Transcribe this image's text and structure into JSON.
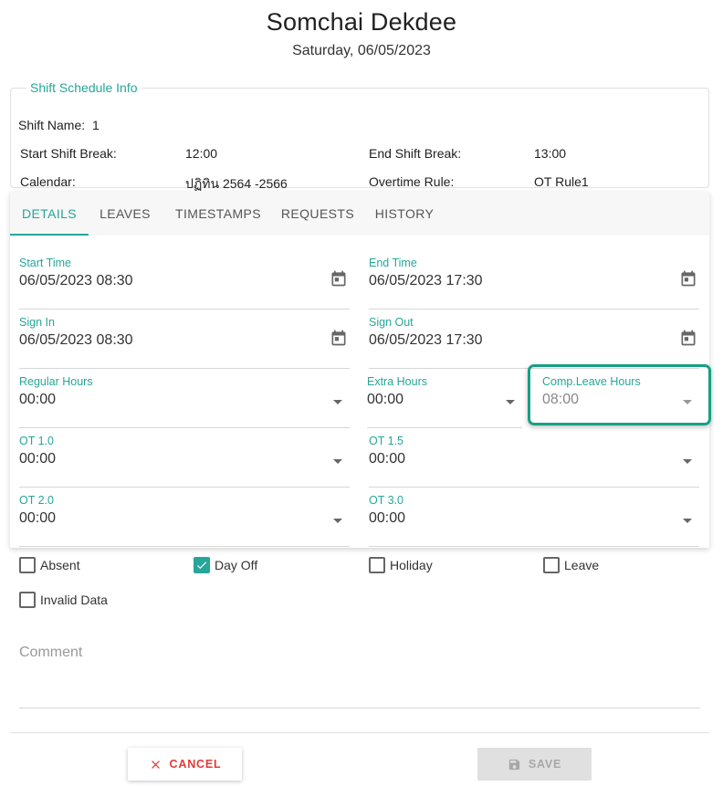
{
  "header": {
    "name": "Somchai Dekdee",
    "date": "Saturday, 06/05/2023"
  },
  "shift_info": {
    "legend": "Shift Schedule Info",
    "shift_name_label": "Shift Name:",
    "shift_name_value": "1",
    "start_break_label": "Start Shift Break:",
    "start_break_value": "12:00",
    "end_break_label": "End Shift Break:",
    "end_break_value": "13:00",
    "calendar_label": "Calendar:",
    "calendar_value": "ปฏิทิน 2564 -2566",
    "ot_rule_label": "Overtime Rule:",
    "ot_rule_value": "OT Rule1"
  },
  "tabs": [
    {
      "label": "DETAILS",
      "active": true
    },
    {
      "label": "LEAVES"
    },
    {
      "label": "TIMESTAMPS"
    },
    {
      "label": "REQUESTS"
    },
    {
      "label": "HISTORY"
    }
  ],
  "fields": {
    "start_time": {
      "label": "Start Time",
      "value": "06/05/2023 08:30"
    },
    "end_time": {
      "label": "End Time",
      "value": "06/05/2023 17:30"
    },
    "sign_in": {
      "label": "Sign In",
      "value": "06/05/2023 08:30"
    },
    "sign_out": {
      "label": "Sign Out",
      "value": "06/05/2023 17:30"
    },
    "regular_hours": {
      "label": "Regular Hours",
      "value": "00:00"
    },
    "extra_hours": {
      "label": "Extra Hours",
      "value": "00:00"
    },
    "comp_leave_hours": {
      "label": "Comp.Leave Hours",
      "value": "08:00"
    },
    "ot_1_0": {
      "label": "OT 1.0",
      "value": "00:00"
    },
    "ot_1_5": {
      "label": "OT 1.5",
      "value": "00:00"
    },
    "ot_2_0": {
      "label": "OT 2.0",
      "value": "00:00"
    },
    "ot_3_0": {
      "label": "OT 3.0",
      "value": "00:00"
    }
  },
  "checkboxes": {
    "absent": {
      "label": "Absent",
      "checked": false
    },
    "day_off": {
      "label": "Day Off",
      "checked": true
    },
    "holiday": {
      "label": "Holiday",
      "checked": false
    },
    "leave": {
      "label": "Leave",
      "checked": false
    },
    "invalid_data": {
      "label": "Invalid Data",
      "checked": false
    }
  },
  "comment": {
    "placeholder": "Comment"
  },
  "buttons": {
    "cancel_label": "CANCEL",
    "save_label": "SAVE"
  },
  "colors": {
    "accent": "#26a69a",
    "highlight": "#16a085",
    "cancel": "#e53935"
  },
  "icons": {
    "date": "calendar-icon",
    "dropdown": "chevron-down-icon",
    "cancel": "close-icon",
    "save": "save-icon"
  }
}
